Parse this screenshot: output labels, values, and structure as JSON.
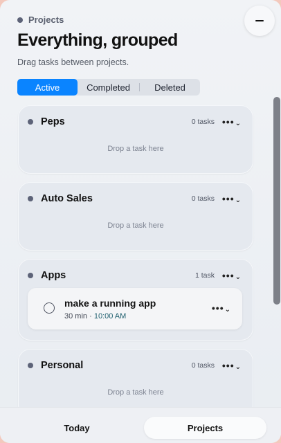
{
  "header": {
    "breadcrumb": "Projects",
    "title": "Everything, grouped",
    "subtitle": "Drag tasks between projects.",
    "minimize_icon": "minus-icon"
  },
  "filters": {
    "tabs": [
      "Active",
      "Completed",
      "Deleted"
    ],
    "selected": "Active"
  },
  "projects": [
    {
      "name": "Peps",
      "count": "0 tasks",
      "empty_text": "Drop a task here"
    },
    {
      "name": "Auto Sales",
      "count": "0 tasks",
      "empty_text": "Drop a task here"
    },
    {
      "name": "Apps",
      "count": "1 task",
      "tasks": [
        {
          "title": "make a running app",
          "duration": "30 min",
          "separator": "·",
          "time": "10:00 AM"
        }
      ]
    },
    {
      "name": "Personal",
      "count": "0 tasks",
      "empty_text": "Drop a task here"
    }
  ],
  "icons": {
    "more": "ellipsis-icon",
    "chevron": "chevron-down-icon",
    "checkbox": "circle-checkbox-icon"
  },
  "glyphs": {
    "more": "•••",
    "chevron": "⌄"
  },
  "bottom_nav": {
    "today": "Today",
    "projects": "Projects",
    "active": "Projects"
  },
  "colors": {
    "accent": "#0a84ff",
    "project_dot": "#5d6378",
    "time_text": "#1e5f6e"
  }
}
